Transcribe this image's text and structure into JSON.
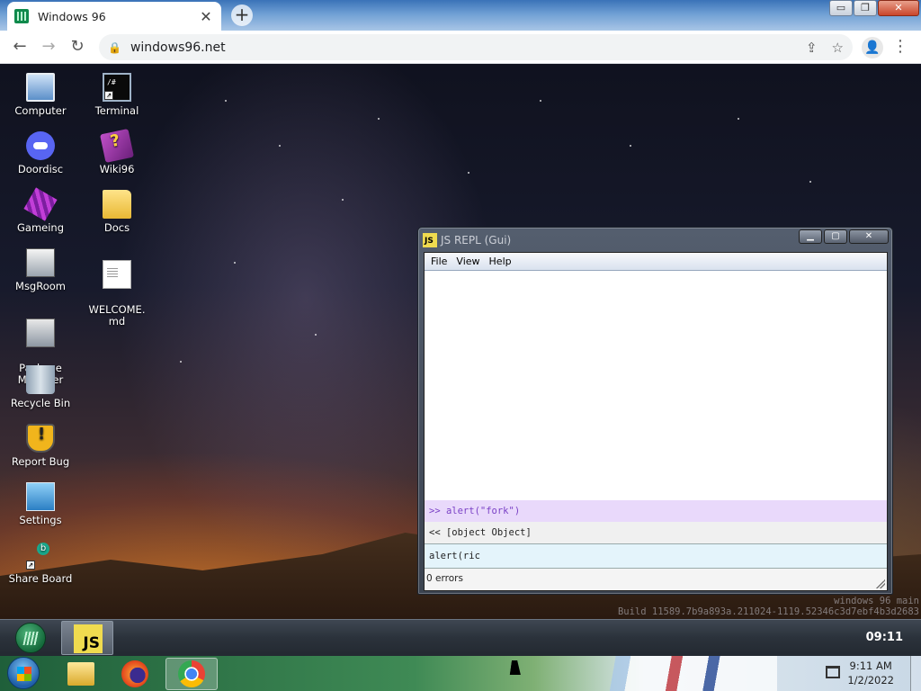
{
  "browser": {
    "tab_title": "Windows 96",
    "tab_close": "✕",
    "new_tab": "+",
    "win_min": "▭",
    "win_restore": "❐",
    "win_close": "✕",
    "back": "←",
    "forward": "→",
    "reload": "↻",
    "lock": "🔒",
    "url": "windows96.net",
    "share": "⇪",
    "bookmark": "☆",
    "profile": "👤",
    "menu": "⋮"
  },
  "desktop_icons": [
    {
      "label": "Computer",
      "icon": "computer-icon"
    },
    {
      "label": "Terminal",
      "icon": "terminal-icon"
    },
    {
      "label": "Doordisc",
      "icon": "discord-icon"
    },
    {
      "label": "Wiki96",
      "icon": "wiki-book-icon"
    },
    {
      "label": "Gameing",
      "icon": "game-cube-icon"
    },
    {
      "label": "Docs",
      "icon": "folder-icon"
    },
    {
      "label": "MsgRoom",
      "icon": "chat-room-icon"
    },
    {
      "label": "WELCOME.\nmd",
      "icon": "document-icon"
    },
    {
      "label": "Package\nManager",
      "icon": "package-icon"
    },
    {
      "label": "Recycle Bin",
      "icon": "recycle-bin-icon"
    },
    {
      "label": "Report Bug",
      "icon": "warning-shield-icon"
    },
    {
      "label": "Settings",
      "icon": "settings-icon"
    },
    {
      "label": "Share Board",
      "icon": "share-board-icon"
    }
  ],
  "build_info": {
    "line1": "windows 96 main",
    "line2": "Build 11589.7b9a893a.211024-1119.52346c3d7ebf4b3d2683"
  },
  "repl": {
    "badge": "JS",
    "title": "JS REPL (Gui)",
    "min": "▁",
    "max": "▢",
    "close": "✕",
    "menus": [
      "File",
      "View",
      "Help"
    ],
    "input_history": ">> alert(\"fork\")",
    "output_history": "<< [object Object]",
    "current_input": "alert(ric",
    "status": "0 errors"
  },
  "taskbar96": {
    "task_badge": "JS",
    "clock": "09:11"
  },
  "host_taskbar": {
    "time": "9:11 AM",
    "date": "1/2/2022"
  }
}
